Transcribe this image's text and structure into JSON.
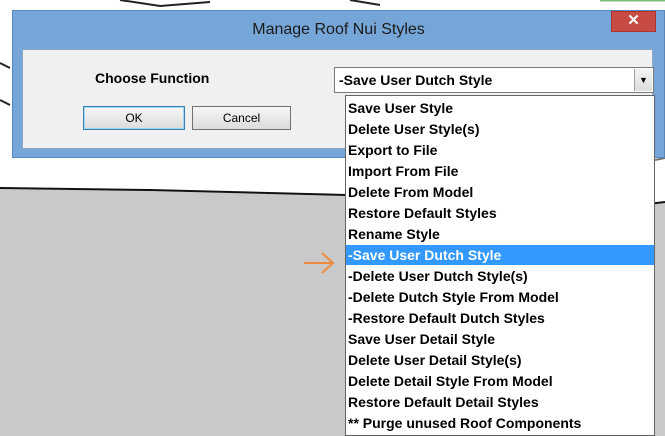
{
  "dialog": {
    "title": "Manage Roof Nui Styles",
    "close_glyph": "✕",
    "choose_label": "Choose Function",
    "ok_label": "OK",
    "cancel_label": "Cancel"
  },
  "combo": {
    "selected_value": "-Save User Dutch Style",
    "arrow_glyph": "▼"
  },
  "dropdown": {
    "selected_index": 7,
    "items": [
      "Save User Style",
      "Delete User Style(s)",
      "Export to File",
      "Import From File",
      "Delete From Model",
      "Restore Default Styles",
      "Rename Style",
      "-Save User Dutch Style",
      "-Delete User Dutch Style(s)",
      "-Delete Dutch Style From Model",
      "-Restore Default Dutch Styles",
      "Save User Detail Style",
      "Delete User Detail Style(s)",
      "Delete Detail Style From Model",
      "Restore Default Detail Styles",
      "** Purge unused Roof Components"
    ]
  },
  "colors": {
    "titlebar": "#76a5d8",
    "close_button": "#c74a43",
    "selection": "#3399ff",
    "annotation_arrow": "#f08a3c",
    "background_plane": "#c9c9c9"
  },
  "icons": {
    "close": "close-icon",
    "dropdown_arrow": "chevron-down-icon",
    "annotation": "arrow-right-icon"
  }
}
